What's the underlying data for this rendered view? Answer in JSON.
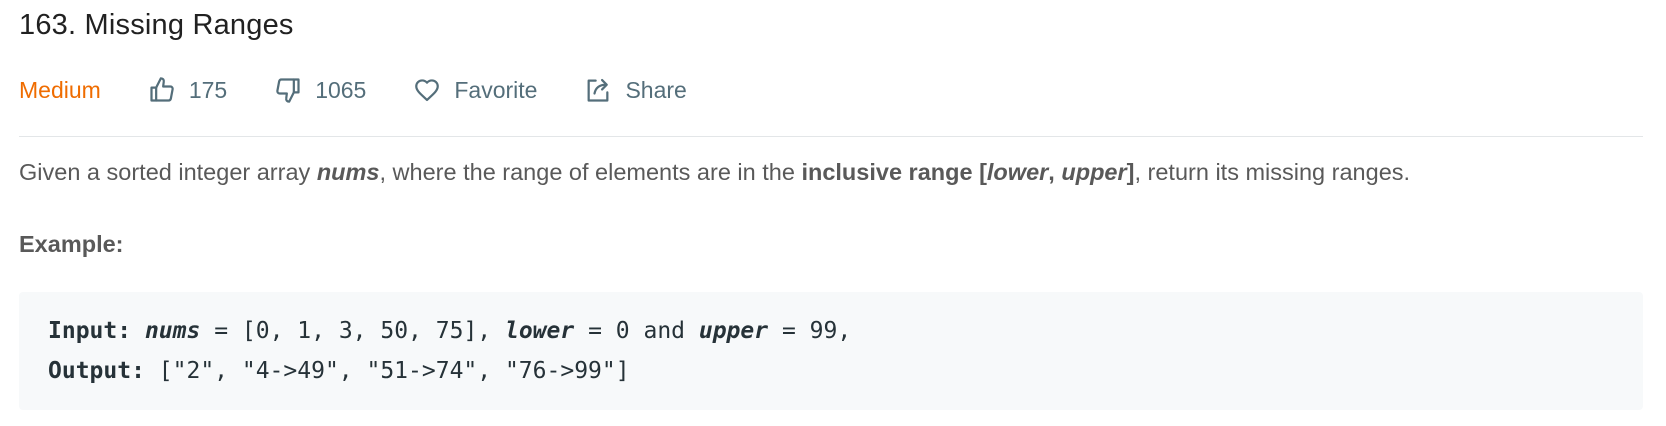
{
  "problem": {
    "title": "163. Missing Ranges",
    "difficulty": "Medium",
    "difficulty_color": "#ef6c00"
  },
  "actions": {
    "like_icon": "thumbs-up-icon",
    "like_count": "175",
    "dislike_icon": "thumbs-down-icon",
    "dislike_count": "1065",
    "favorite_icon": "heart-icon",
    "favorite_label": "Favorite",
    "share_icon": "share-icon",
    "share_label": "Share"
  },
  "description": {
    "p1": "Given a sorted integer array ",
    "nums": "nums",
    "p2": ", where the range of elements are in the ",
    "inclusive_range": "inclusive range [",
    "lower": "lower",
    "comma": ", ",
    "upper": "upper",
    "close": "]",
    "p3": ", return its missing ranges."
  },
  "example": {
    "label": "Example:",
    "input_label": "Input:",
    "input_nums_var": "nums",
    "input_nums_val": " = [0, 1, 3, 50, 75], ",
    "input_lower_var": "lower",
    "input_lower_val": " = 0 and ",
    "input_upper_var": "upper",
    "input_upper_val": " = 99,",
    "output_label": "Output:",
    "output_val": " [\"2\", \"4->49\", \"51->74\", \"76->99\"]"
  }
}
